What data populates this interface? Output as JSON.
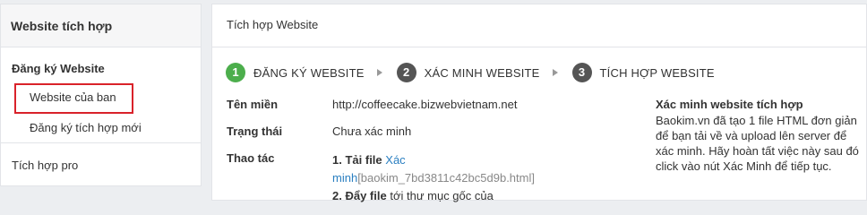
{
  "sidebar": {
    "title": "Website tích hợp",
    "section": "Đăng ký Website",
    "items": [
      {
        "label": "Website của ban"
      },
      {
        "label": "Đăng ký tích hợp mới"
      }
    ],
    "pro": "Tích hợp pro"
  },
  "main": {
    "header": "Tích hợp Website",
    "steps": [
      {
        "num": "1",
        "label": "ĐĂNG KÝ WEBSITE",
        "status": "done"
      },
      {
        "num": "2",
        "label": "XÁC MINH WEBSITE",
        "status": "todo"
      },
      {
        "num": "3",
        "label": "TÍCH HỢP WEBSITE",
        "status": "todo"
      }
    ],
    "fields": {
      "domain_label": "Tên miền",
      "domain_value": "http://coffeecake.bizwebvietnam.net",
      "status_label": "Trạng thái",
      "status_value": "Chưa xác minh",
      "action_label": "Thao tác"
    },
    "actions": {
      "a1_num": "1.",
      "a1_bold": "Tải file",
      "a1_link_part1": "Xác",
      "a1_link_part2": "minh",
      "a1_code": "[baokim_7bd3811c42bc5d9b.html]",
      "a2_num": "2.",
      "a2_bold": "Đẩy file",
      "a2_text": "tới thư mục gốc của"
    },
    "verify": {
      "title": "Xác minh website tích hợp",
      "body": "Baokim.vn đã tạo 1 file HTML đơn giản để bạn tải về và upload lên server để xác minh. Hãy hoàn tất việc này sau đó click vào nút Xác Minh để tiếp tục."
    }
  },
  "colors": {
    "accent_link": "#2a7fc1",
    "step_done": "#4cae4c",
    "step_todo": "#555555",
    "highlight_border": "#d9222a"
  }
}
